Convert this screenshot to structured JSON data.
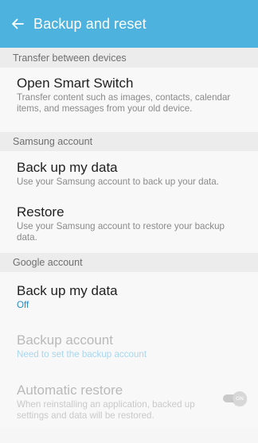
{
  "appbar": {
    "title": "Backup and reset"
  },
  "sections": {
    "transfer": {
      "header": "Transfer between devices",
      "smart_switch": {
        "title": "Open Smart Switch",
        "subtitle": "Transfer content such as images, contacts, calendar items, and messages from your old device."
      }
    },
    "samsung": {
      "header": "Samsung account",
      "backup": {
        "title": "Back up my data",
        "subtitle": "Use your Samsung account to back up your data."
      },
      "restore": {
        "title": "Restore",
        "subtitle": "Use your Samsung account to restore your backup data."
      }
    },
    "google": {
      "header": "Google account",
      "backup": {
        "title": "Back up my data",
        "status": "Off"
      },
      "backup_account": {
        "title": "Backup account",
        "status": "Need to set the backup account"
      },
      "auto_restore": {
        "title": "Automatic restore",
        "subtitle": "When reinstalling an application, backed up settings and data will be restored.",
        "toggle_label": "ON"
      }
    }
  },
  "colors": {
    "appbar": "#4eb2de",
    "accent": "#2a8fc7"
  }
}
